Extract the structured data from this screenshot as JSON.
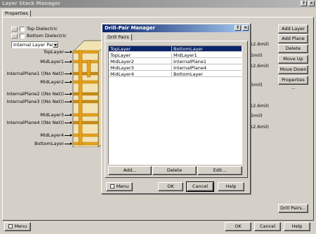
{
  "main_window": {
    "title": "Layer Stack Manager",
    "tab_label": "Properties",
    "top_dielectric_label": "Top Dielectric",
    "bottom_dielectric_label": "Bottom Dielectric",
    "layer_pairs_select": "Internal Layer Pairs",
    "layer_labels": [
      "TopLayer",
      "MidLayer1",
      "InternalPlane1 ((No Net))",
      "MidLayer2",
      "InternalPlane2 ((No Net))",
      "InternalPlane3 ((No Net))",
      "MidLayer3",
      "InternalPlane4 ((No Net))",
      "MidLayer4",
      "BottomLayer"
    ],
    "thickness_labels": [
      "12.6mil)",
      "5mil)",
      "12.6mil)",
      "5mil)",
      "12.6mil)",
      "5mil)",
      "12.6mil)"
    ],
    "side_buttons": {
      "add_layer": "Add Layer",
      "add_plane": "Add Plane",
      "delete": "Delete",
      "move_up": "Move Up",
      "move_down": "Move Down",
      "properties": "Properties ..."
    },
    "drill_pairs_button": "Drill Pairs...",
    "menu_button": "Menu",
    "ok_button": "OK",
    "cancel_button": "Cancel",
    "help_button": "Help"
  },
  "drill_dialog": {
    "title": "Drill-Pair Manager",
    "help_glyph": "?",
    "close_glyph": "×",
    "tab_label": "Drill Pairs",
    "rows": [
      [
        "TopLayer",
        "BottomLayer"
      ],
      [
        "TopLayer",
        "MidLayer1"
      ],
      [
        "MidLayer2",
        "InternalPlane1"
      ],
      [
        "MidLayer3",
        "InternalPlane4"
      ],
      [
        "MidLayer4",
        "BottomLayer"
      ]
    ],
    "selected_row": 0,
    "add_button": "Add...",
    "delete_button": "Delete",
    "edit_button": "Edit...",
    "menu_button": "Menu",
    "ok_button": "OK",
    "cancel_button": "Cancel",
    "help_button": "Help"
  },
  "colors": {
    "copper": "#e6a01c",
    "dielectric": "#f2e3b4",
    "plane": "#c88a12",
    "selection": "#0a246a"
  }
}
